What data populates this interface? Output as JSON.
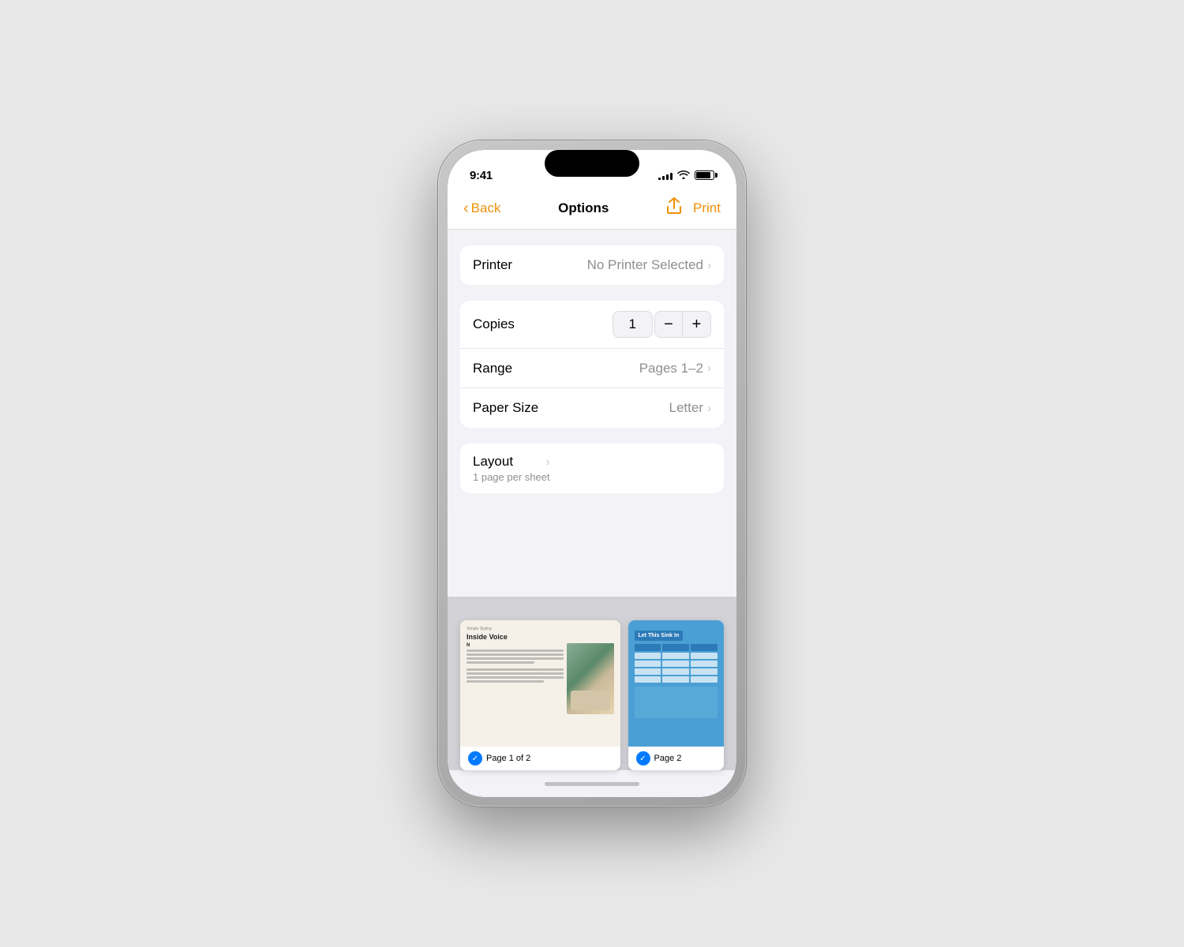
{
  "statusBar": {
    "time": "9:41",
    "signalBars": [
      3,
      5,
      7,
      9,
      11
    ],
    "batteryLevel": 85
  },
  "navBar": {
    "backLabel": "Back",
    "title": "Options",
    "printLabel": "Print"
  },
  "printer": {
    "label": "Printer",
    "value": "No Printer Selected"
  },
  "copies": {
    "label": "Copies",
    "value": "1",
    "decrementLabel": "−",
    "incrementLabel": "+"
  },
  "range": {
    "label": "Range",
    "value": "Pages 1–2"
  },
  "paperSize": {
    "label": "Paper Size",
    "value": "Letter"
  },
  "layout": {
    "label": "Layout",
    "sublabel": "1 page per sheet"
  },
  "pages": [
    {
      "label": "Page 1 of 2",
      "type": "magazine"
    },
    {
      "label": "Page 2",
      "type": "blue"
    }
  ]
}
